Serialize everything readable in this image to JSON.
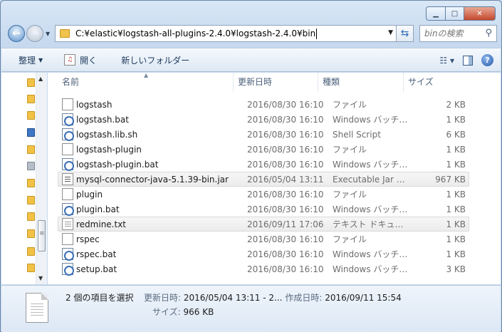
{
  "window": {
    "minimize_glyph": "▁",
    "maximize_glyph": "□",
    "close_glyph": "✕"
  },
  "address": {
    "path": "C:¥elastic¥logstash-all-plugins-2.4.0¥logstash-2.4.0¥bin",
    "search_placeholder": "binの検索"
  },
  "toolbar": {
    "organize": "整理",
    "open": "開く",
    "new_folder": "新しいフォルダー"
  },
  "columns": {
    "name": "名前",
    "date": "更新日時",
    "type": "種類",
    "size": "サイズ"
  },
  "files": [
    {
      "name": "logstash",
      "date": "2016/08/30 16:10",
      "type": "ファイル",
      "size": "2 KB",
      "icon": "file-icon",
      "selected": false
    },
    {
      "name": "logstash.bat",
      "date": "2016/08/30 16:10",
      "type": "Windows バッチ…",
      "size": "1 KB",
      "icon": "batch-file-icon",
      "selected": false
    },
    {
      "name": "logstash.lib.sh",
      "date": "2016/08/30 16:10",
      "type": "Shell Script",
      "size": "6 KB",
      "icon": "batch-file-icon",
      "selected": false
    },
    {
      "name": "logstash-plugin",
      "date": "2016/08/30 16:10",
      "type": "ファイル",
      "size": "1 KB",
      "icon": "file-icon",
      "selected": false
    },
    {
      "name": "logstash-plugin.bat",
      "date": "2016/08/30 16:10",
      "type": "Windows バッチ…",
      "size": "1 KB",
      "icon": "batch-file-icon",
      "selected": false
    },
    {
      "name": "mysql-connector-java-5.1.39-bin.jar",
      "date": "2016/05/04 13:11",
      "type": "Executable Jar …",
      "size": "967 KB",
      "icon": "jar-file-icon",
      "selected": true
    },
    {
      "name": "plugin",
      "date": "2016/08/30 16:10",
      "type": "ファイル",
      "size": "1 KB",
      "icon": "file-icon",
      "selected": false
    },
    {
      "name": "plugin.bat",
      "date": "2016/08/30 16:10",
      "type": "Windows バッチ…",
      "size": "1 KB",
      "icon": "batch-file-icon",
      "selected": false
    },
    {
      "name": "redmine.txt",
      "date": "2016/09/11 17:06",
      "type": "テキスト ドキュ…",
      "size": "1 KB",
      "icon": "text-file-icon",
      "selected": true
    },
    {
      "name": "rspec",
      "date": "2016/08/30 16:10",
      "type": "ファイル",
      "size": "1 KB",
      "icon": "file-icon",
      "selected": false
    },
    {
      "name": "rspec.bat",
      "date": "2016/08/30 16:10",
      "type": "Windows バッチ…",
      "size": "1 KB",
      "icon": "batch-file-icon",
      "selected": false
    },
    {
      "name": "setup.bat",
      "date": "2016/08/30 16:10",
      "type": "Windows バッチ…",
      "size": "3 KB",
      "icon": "batch-file-icon",
      "selected": false
    }
  ],
  "details": {
    "count": "2 個の項目を選択",
    "modified_label": "更新日時:",
    "modified_value": "2016/05/04 13:11 - 2...",
    "created_label": "作成日時:",
    "created_value": "2016/09/11 15:54",
    "size_label": "サイズ:",
    "size_value": "966 KB"
  }
}
